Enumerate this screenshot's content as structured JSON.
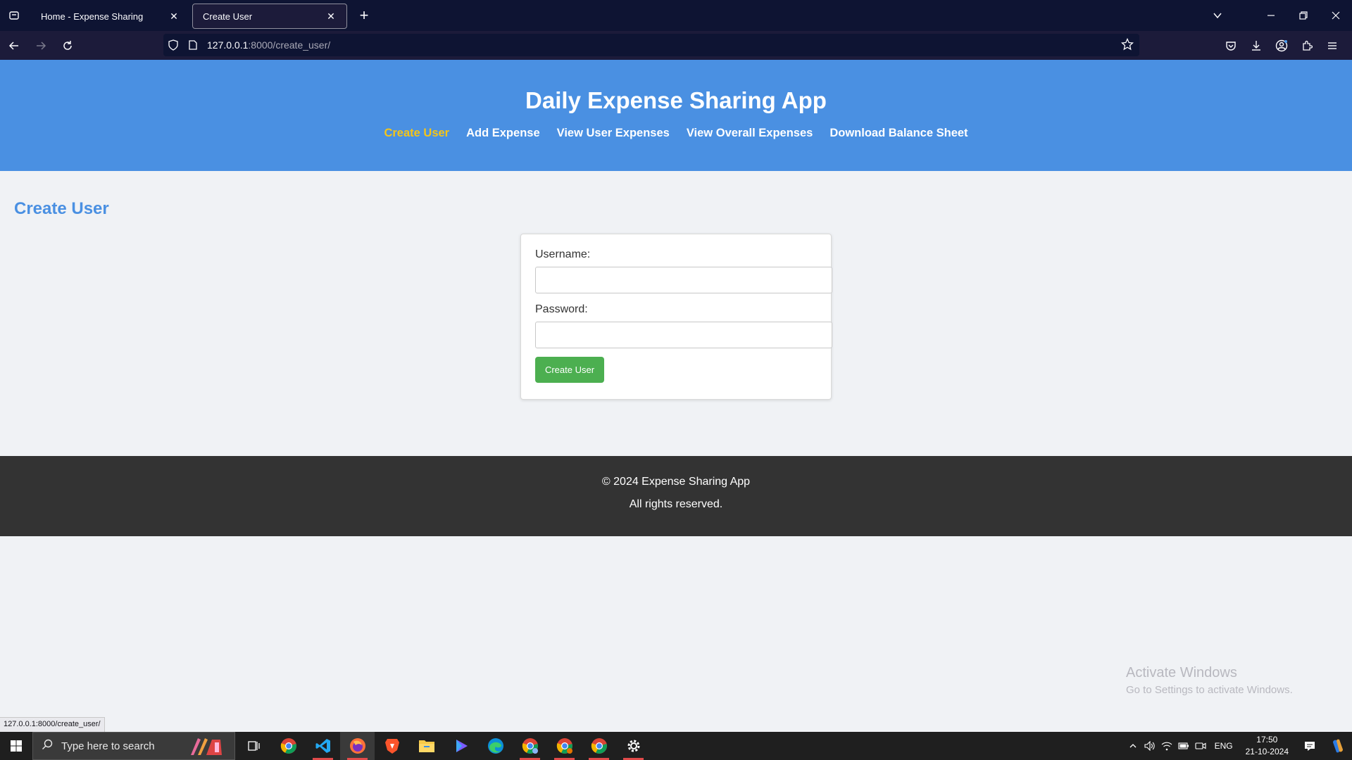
{
  "browser": {
    "tabs": [
      {
        "title": "Home - Expense Sharing",
        "active": false
      },
      {
        "title": "Create User",
        "active": true
      }
    ],
    "url_host": "127.0.0.1",
    "url_path": ":8000/create_user/",
    "status_link": "127.0.0.1:8000/create_user/"
  },
  "site": {
    "title": "Daily Expense Sharing App",
    "nav": [
      {
        "label": "Create User",
        "current": true
      },
      {
        "label": "Add Expense",
        "current": false
      },
      {
        "label": "View User Expenses",
        "current": false
      },
      {
        "label": "View Overall Expenses",
        "current": false
      },
      {
        "label": "Download Balance Sheet",
        "current": false
      }
    ],
    "page_heading": "Create User",
    "form": {
      "username_label": "Username:",
      "username_value": "",
      "password_label": "Password:",
      "password_value": "",
      "submit_label": "Create User"
    },
    "footer": {
      "copyright": "© 2024 Expense Sharing App",
      "rights": "All rights reserved."
    }
  },
  "watermark": {
    "title": "Activate Windows",
    "subtitle": "Go to Settings to activate Windows."
  },
  "taskbar": {
    "search_placeholder": "Type here to search",
    "apps": [
      "chrome-icon",
      "vscode-icon",
      "firefox-icon",
      "brave-icon",
      "file-explorer-icon",
      "media-player-icon",
      "edge-icon",
      "chrome-profile-icon",
      "chrome-profile-2-icon",
      "chrome-icon-3",
      "settings-icon"
    ],
    "lang": "ENG",
    "time": "17:50",
    "date": "21-10-2024"
  },
  "colors": {
    "header_bg": "#4a90e2",
    "nav_current": "#f5c518",
    "submit_bg": "#4caf50",
    "footer_bg": "#333333"
  }
}
